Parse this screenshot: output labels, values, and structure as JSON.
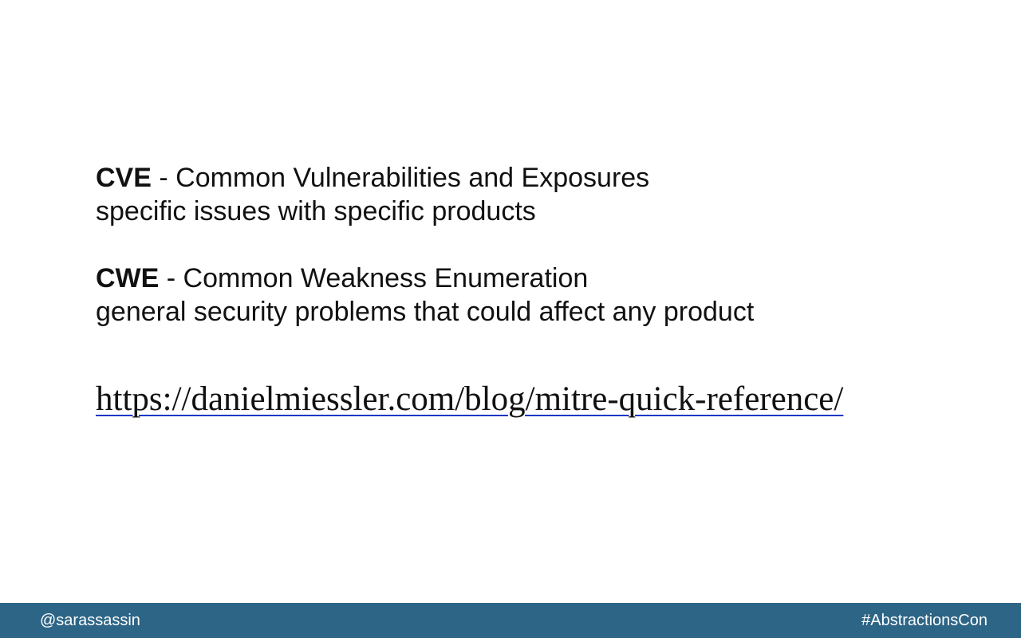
{
  "slide": {
    "terms": [
      {
        "abbr": "CVE",
        "separator": " - ",
        "expansion": "Common Vulnerabilities and Exposures",
        "description": "specific issues with specific products"
      },
      {
        "abbr": "CWE",
        "separator": " - ",
        "expansion": "Common Weakness Enumeration",
        "description": "general security problems that could affect any product"
      }
    ],
    "link": {
      "text": "https://danielmiessler.com/blog/mitre-quick-reference/"
    }
  },
  "footer": {
    "handle": "@sarassassin",
    "hashtag": "#AbstractionsCon"
  },
  "colors": {
    "footer_background": "#2d6586",
    "link_underline": "#1a36c7",
    "text": "#111111"
  }
}
